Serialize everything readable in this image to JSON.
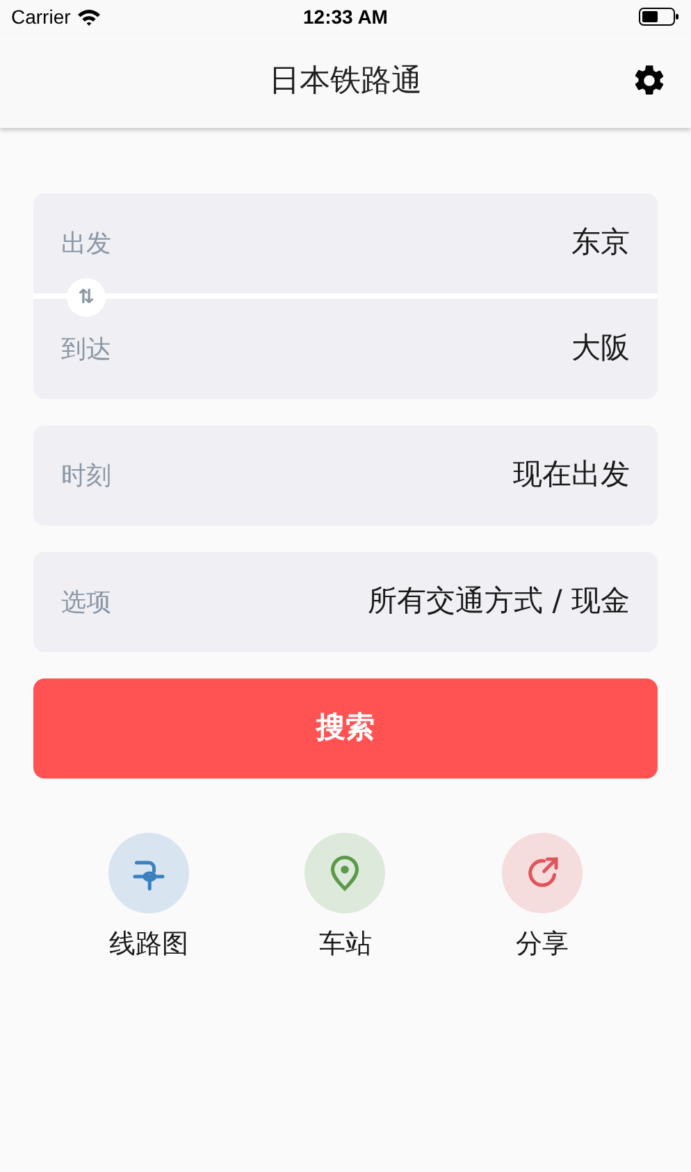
{
  "status_bar": {
    "carrier": "Carrier",
    "time": "12:33 AM"
  },
  "nav": {
    "title": "日本铁路通"
  },
  "route": [
    {
      "label": "出发",
      "value": "东京"
    },
    {
      "label": "到达",
      "value": "大阪"
    }
  ],
  "swap": {
    "label": "⇅"
  },
  "fields": [
    {
      "label": "时刻",
      "value": "现在出发"
    },
    {
      "label": "选项",
      "value": "所有交通方式 / 现金"
    }
  ],
  "search_button": "搜索",
  "shortcuts": [
    {
      "kind": "map",
      "label": "线路图",
      "color": "#3b7fc0"
    },
    {
      "kind": "station",
      "label": "车站",
      "color": "#5a9a48"
    },
    {
      "kind": "share",
      "label": "分享",
      "color": "#e0555a"
    }
  ]
}
